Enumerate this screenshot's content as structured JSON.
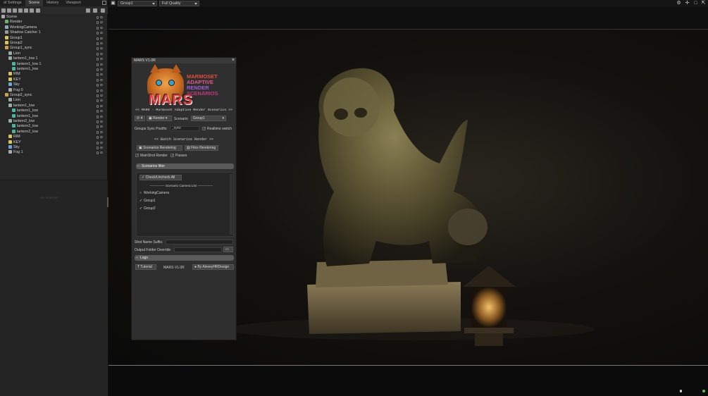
{
  "left_panel": {
    "tabs": [
      "ol Settings",
      "Scene",
      "History",
      "Viewport"
    ],
    "tree": [
      {
        "label": "Scene",
        "indent": 0,
        "icon": "scene-icon"
      },
      {
        "label": "Render",
        "indent": 1,
        "icon": "render-icon"
      },
      {
        "label": "WorkingCamera",
        "indent": 1,
        "icon": "camera-icon"
      },
      {
        "label": "Shadow Catcher 1",
        "indent": 1,
        "icon": "shadow-catcher-icon"
      },
      {
        "label": "Group1",
        "indent": 1,
        "icon": "light-icon"
      },
      {
        "label": "Group2",
        "indent": 1,
        "icon": "light-icon"
      },
      {
        "label": "Group1_sync",
        "indent": 1,
        "icon": "folder-icon"
      },
      {
        "label": "Lion",
        "indent": 2,
        "icon": "mesh-icon"
      },
      {
        "label": "lantern1_low 1",
        "indent": 2,
        "icon": "mesh-icon"
      },
      {
        "label": "lantern1_low 1",
        "indent": 3,
        "icon": "material-icon"
      },
      {
        "label": "lantern1_low",
        "indent": 3,
        "icon": "material-icon"
      },
      {
        "label": "RIM",
        "indent": 2,
        "icon": "light-icon"
      },
      {
        "label": "KEY",
        "indent": 2,
        "icon": "light-icon"
      },
      {
        "label": "Sky",
        "indent": 2,
        "icon": "sky-icon"
      },
      {
        "label": "Fog 0",
        "indent": 2,
        "icon": "fog-icon"
      },
      {
        "label": "Group2_sync",
        "indent": 1,
        "icon": "folder-icon"
      },
      {
        "label": "Lion",
        "indent": 2,
        "icon": "mesh-icon"
      },
      {
        "label": "lantern1_low",
        "indent": 2,
        "icon": "mesh-icon"
      },
      {
        "label": "lantern1_low",
        "indent": 3,
        "icon": "material-icon"
      },
      {
        "label": "lantern1_low",
        "indent": 3,
        "icon": "material-icon"
      },
      {
        "label": "lantern2_low",
        "indent": 2,
        "icon": "mesh-icon"
      },
      {
        "label": "lantern2_low",
        "indent": 3,
        "icon": "material-icon"
      },
      {
        "label": "lantern2_low",
        "indent": 3,
        "icon": "material-icon"
      },
      {
        "label": "RIM",
        "indent": 2,
        "icon": "light-icon"
      },
      {
        "label": "KEY",
        "indent": 2,
        "icon": "light-icon"
      },
      {
        "label": "Sky",
        "indent": 2,
        "icon": "sky-icon"
      },
      {
        "label": "Fog 1",
        "indent": 2,
        "icon": "fog-icon"
      }
    ],
    "lower_empty_text": "No Selection"
  },
  "topbar": {
    "camera_select": "Group1",
    "quality_select": "Full Quality"
  },
  "mars": {
    "title": "MARS V1.0R",
    "logo_word": "MARS",
    "logo_lines": [
      "MARMOSET",
      "ADAPTIVE",
      "RENDER",
      "SCENARIOS"
    ],
    "subtitle": "<< MARS - Marmoset Adaptive Render Scenarios >>",
    "refresh_count": "4",
    "render_button": "Render",
    "scenario_label": "Scenario",
    "scenario_value": "Group1",
    "groups_sync_label": "Groups Sync Postfix:",
    "groups_sync_value": "_sync",
    "realtime_switch": "Realtime switch",
    "batch_header": "<< Batch Scenarios Render >>",
    "scenarios_rendering": "Scenarios Rendering",
    "files_rendering": "Files Rendering",
    "mainshot_render": "MainShot Render",
    "passes": "Passes",
    "scenarios_filter": "Scenarios filter",
    "check_uncheck_all": "Check/Uncheck All",
    "camera_list_header": "Scenario Camera List",
    "cameras": [
      {
        "name": "WorkingCamera",
        "checked": false
      },
      {
        "name": "Group1",
        "checked": true
      },
      {
        "name": "Group2",
        "checked": true
      }
    ],
    "shot_name_suffix": "Shot Name Suffix:",
    "output_folder": "Output Folder Override",
    "logs": "Logs",
    "tutorial": "Tutorial",
    "version": "MARS V1.0R",
    "credits": "By AlexeyHRDesign"
  }
}
